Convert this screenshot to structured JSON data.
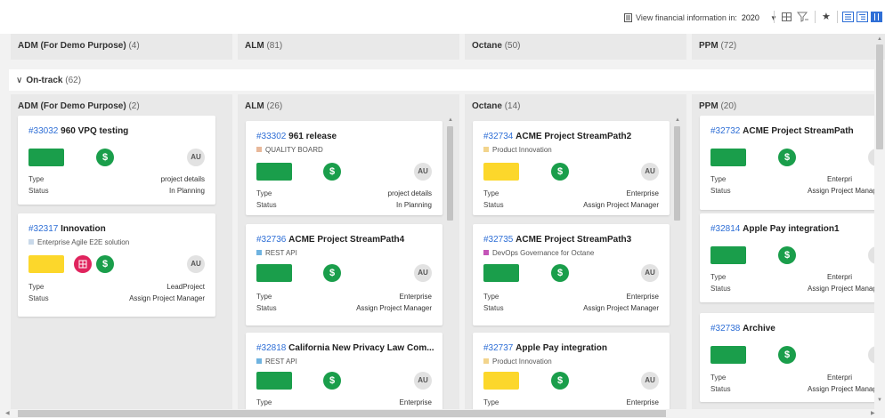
{
  "toolbar": {
    "financial_label": "View financial information in:",
    "year": "2020",
    "icons": [
      "calculator-icon",
      "chevron-down-icon",
      "grid-icon",
      "filter-icon",
      "star-icon",
      "list-view-icon",
      "tree-view-icon",
      "board-view-icon"
    ]
  },
  "columns": [
    {
      "name": "ADM (For Demo Purpose)",
      "count": "(4)"
    },
    {
      "name": "ALM",
      "count": "(81)"
    },
    {
      "name": "Octane",
      "count": "(50)"
    },
    {
      "name": "PPM",
      "count": "(72)"
    }
  ],
  "group": {
    "name": "On-track",
    "count": "(62)"
  },
  "lanes": [
    {
      "name": "ADM (For Demo Purpose)",
      "count": "(2)"
    },
    {
      "name": "ALM",
      "count": "(26)"
    },
    {
      "name": "Octane",
      "count": "(14)"
    },
    {
      "name": "PPM",
      "count": "(20)"
    }
  ],
  "labels": {
    "type": "Type",
    "status": "Status"
  },
  "cards": [
    {
      "id": "#33032",
      "name": "960 VPQ testing",
      "type": "project details",
      "status": "In Planning",
      "avatar": "AU",
      "financial_symbol": "$"
    },
    {
      "id": "#32317",
      "name": "Innovation",
      "subtitle": "Enterprise Agile E2E solution",
      "type": "LeadProject",
      "status": "Assign Project Manager",
      "avatar": "AU",
      "financial_symbol": "$"
    },
    {
      "id": "#33302",
      "name": "961 release",
      "subtitle": "QUALITY BOARD",
      "type": "project details",
      "status": "In Planning",
      "avatar": "AU",
      "financial_symbol": "$"
    },
    {
      "id": "#32736",
      "name": "ACME Project StreamPath4",
      "subtitle": "REST API",
      "type": "Enterprise",
      "status": "Assign Project Manager",
      "avatar": "AU",
      "financial_symbol": "$"
    },
    {
      "id": "#32818",
      "name": "California New Privacy Law Com...",
      "subtitle": "REST API",
      "type": "Enterprise",
      "avatar": "AU",
      "financial_symbol": "$"
    },
    {
      "id": "#32734",
      "name": "ACME Project StreamPath2",
      "subtitle": "Product Innovation",
      "type": "Enterprise",
      "status": "Assign Project Manager",
      "avatar": "AU",
      "financial_symbol": "$"
    },
    {
      "id": "#32735",
      "name": "ACME Project StreamPath3",
      "subtitle": "DevOps Governance for Octane",
      "type": "Enterprise",
      "status": "Assign Project Manager",
      "avatar": "AU",
      "financial_symbol": "$"
    },
    {
      "id": "#32737",
      "name": "Apple Pay integration",
      "subtitle": "Product Innovation",
      "type": "Enterprise",
      "avatar": "AU",
      "financial_symbol": "$"
    },
    {
      "id": "#32732",
      "name": "ACME Project StreamPath",
      "type": "Enterpri",
      "status": "Assign Project Manag",
      "avatar": "A",
      "financial_symbol": "$"
    },
    {
      "id": "#32814",
      "name": "Apple Pay integration1",
      "type": "Enterpri",
      "status": "Assign Project Manag",
      "avatar": "A",
      "financial_symbol": "$"
    },
    {
      "id": "#32738",
      "name": "Archive",
      "type": "Enterpri",
      "status": "Assign Project Manag",
      "avatar": "A",
      "financial_symbol": "$"
    }
  ],
  "colors": {
    "green": "#1a9e4b",
    "yellow": "#fcd72b",
    "risk": "#e0245e",
    "link": "#2f6fd6",
    "quality_board": "#e8b89a",
    "rest_api": "#6fb3e0",
    "product_innovation": "#f2d48c",
    "devops": "#c455b8",
    "enterprise_agile": "#c9d9ea"
  }
}
